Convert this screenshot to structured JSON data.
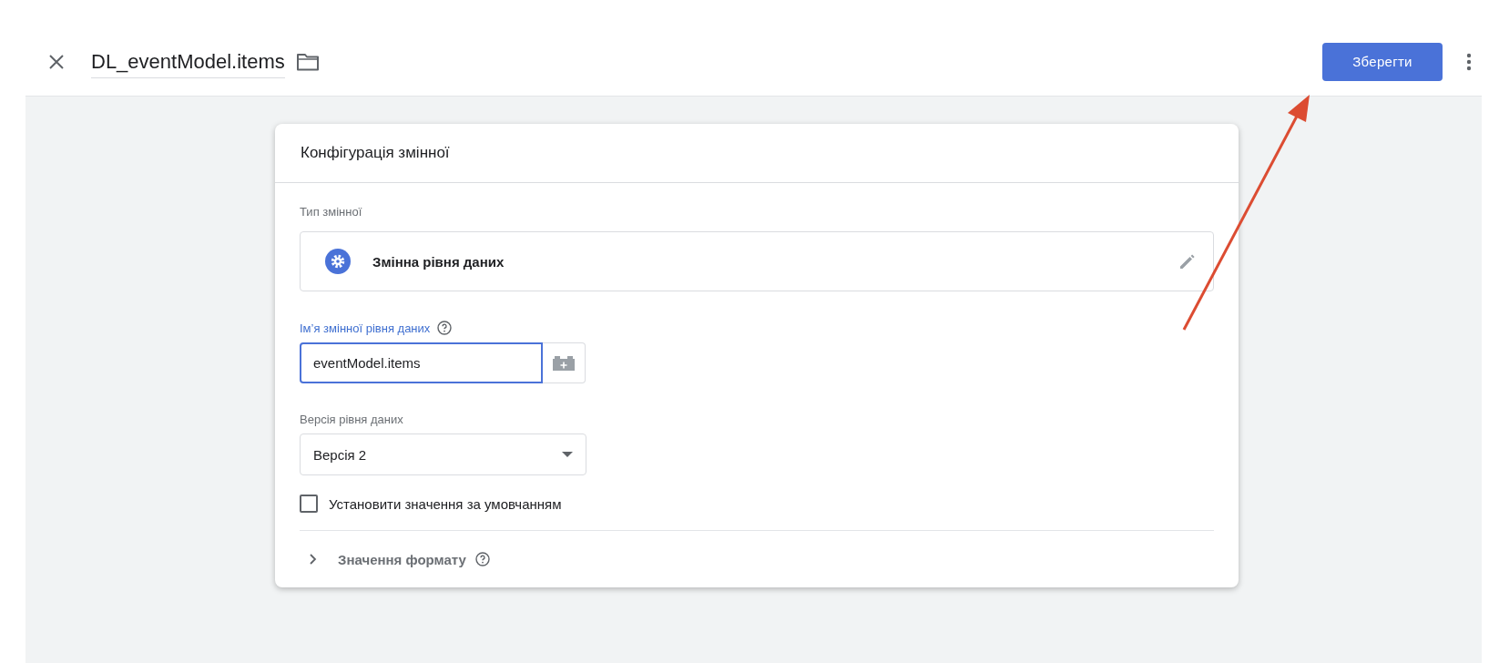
{
  "header": {
    "title": "DL_eventModel.items",
    "save_button": "Зберегти"
  },
  "card": {
    "title": "Конфігурація змінної",
    "type_label": "Тип змінної",
    "type_name": "Змінна рівня даних",
    "name_field": {
      "label": "Ім’я змінної рівня даних",
      "value": "eventModel.items",
      "focused": true
    },
    "version_field": {
      "label": "Версія рівня даних",
      "value": "Версія 2"
    },
    "default_checkbox": {
      "label": "Установити значення за умовчанням",
      "checked": false
    },
    "format_section": {
      "label": "Значення формату",
      "expanded": false
    }
  }
}
